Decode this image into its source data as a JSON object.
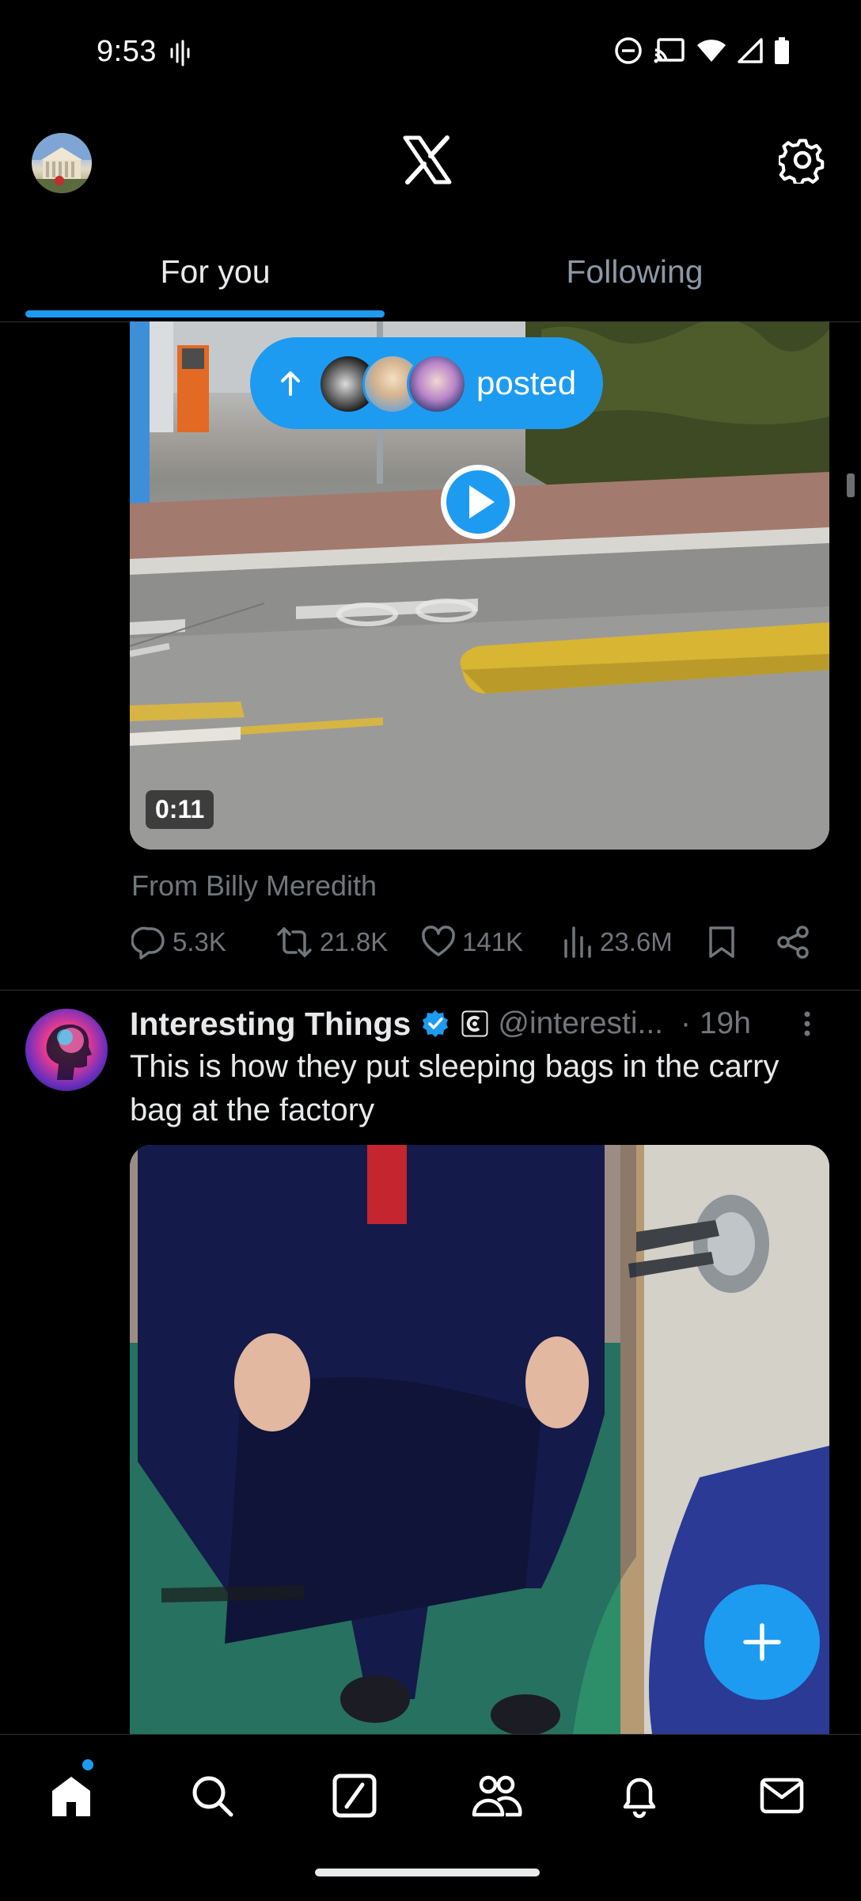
{
  "status_bar": {
    "time": "9:53",
    "icons": [
      "vibrate-icon",
      "do-not-disturb-icon",
      "cast-icon",
      "wifi-icon",
      "signal-icon",
      "battery-icon"
    ]
  },
  "header": {
    "logo": "x-logo",
    "settings_icon": "gear-icon"
  },
  "tabs": [
    {
      "label": "For you",
      "selected": true
    },
    {
      "label": "Following",
      "selected": false
    }
  ],
  "posted_pill": {
    "label": "posted",
    "arrow_icon": "arrow-up-icon"
  },
  "post1": {
    "video_duration": "0:11",
    "from_text": "From Billy Meredith",
    "stats": {
      "replies": "5.3K",
      "reposts": "21.8K",
      "likes": "141K",
      "views": "23.6M"
    }
  },
  "post2": {
    "name": "Interesting Things",
    "handle": "@interesti...",
    "time": "· 19h",
    "text": "This is how they put sleeping bags in the carry bag at the factory"
  },
  "nav": [
    "home-icon",
    "search-icon",
    "grok-icon",
    "communities-icon",
    "notifications-icon",
    "messages-icon"
  ],
  "colors": {
    "accent": "#1d9bf0",
    "background": "#000000",
    "muted_text": "#71767b",
    "primary_text": "#e7e9ea"
  }
}
